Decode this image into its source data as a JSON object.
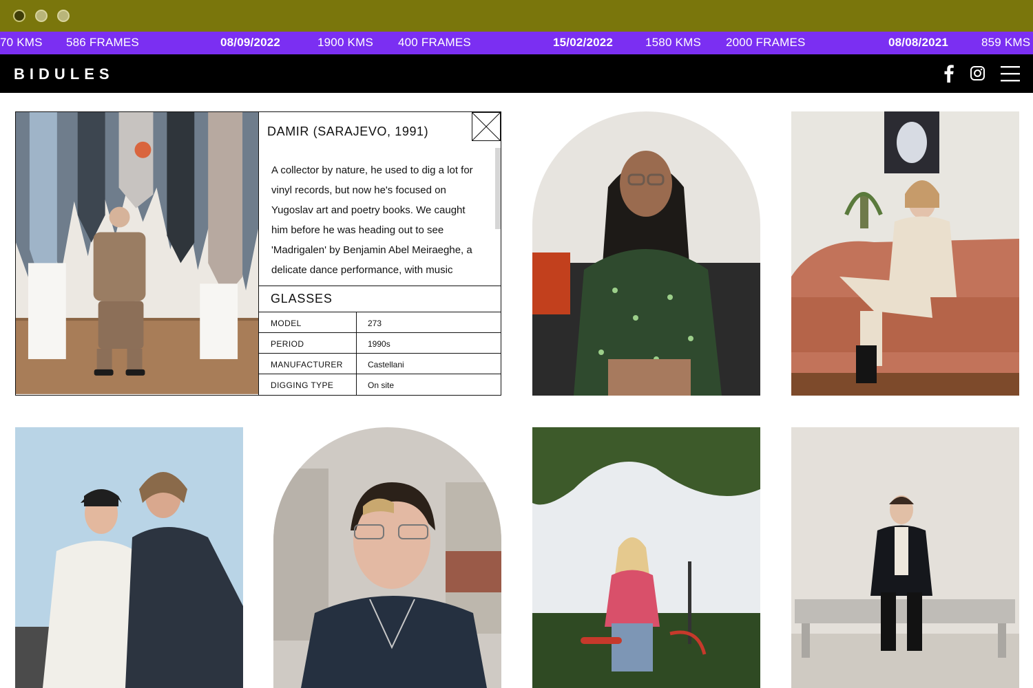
{
  "ticker": [
    {
      "text": "70 KMS",
      "bold": false
    },
    {
      "text": "586 FRAMES",
      "bold": false
    },
    {
      "text": "08/09/2022",
      "bold": true
    },
    {
      "text": "1900 KMS",
      "bold": false
    },
    {
      "text": "400 FRAMES",
      "bold": false
    },
    {
      "text": "15/02/2022",
      "bold": true
    },
    {
      "text": "1580 KMS",
      "bold": false
    },
    {
      "text": "2000 FRAMES",
      "bold": false
    },
    {
      "text": "08/08/2021",
      "bold": true
    },
    {
      "text": "859 KMS",
      "bold": false
    }
  ],
  "header": {
    "logo": "BIDULES",
    "icons": [
      "facebook-icon",
      "instagram-icon",
      "menu-icon"
    ]
  },
  "panel": {
    "title": "DAMIR (SARAJEVO, 1991)",
    "description": "A collector by nature, he used to dig a lot for vinyl records, but now he's focused on Yugoslav art and poetry books. We caught him before he was heading out to see 'Madrigalen' by Benjamin Abel Meiraeghe, a delicate dance performance, with music",
    "section": "GLASSES",
    "specs": [
      {
        "label": "MODEL",
        "value": "273"
      },
      {
        "label": "PERIOD",
        "value": "1990s"
      },
      {
        "label": "MANUFACTURER",
        "value": "Castellani"
      },
      {
        "label": "DIGGING TYPE",
        "value": "On site"
      }
    ]
  },
  "colors": {
    "chrome": "#7a760c",
    "ticker": "#7b2ff2",
    "header": "#000000"
  }
}
